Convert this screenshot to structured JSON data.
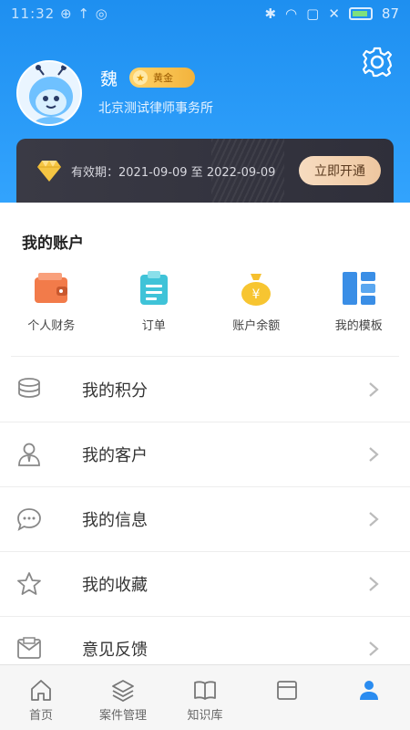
{
  "status_bar": {
    "left_text": "11:32 ⊕ ↑ ◎",
    "battery": "87"
  },
  "profile": {
    "name": "魏",
    "badge": "黄金",
    "firm": "北京测试律师事务所"
  },
  "membership": {
    "validity": "有效期：2021-09-09 至 2022-09-09",
    "button_label": "立即开通"
  },
  "account": {
    "title": "我的账户",
    "items": [
      {
        "label": "个人财务",
        "icon": "wallet-icon"
      },
      {
        "label": "订单",
        "icon": "clipboard-icon"
      },
      {
        "label": "账户余额",
        "icon": "money-bag-icon"
      },
      {
        "label": "我的模板",
        "icon": "template-grid-icon"
      }
    ]
  },
  "menu": [
    {
      "label": "我的积分",
      "icon": "coins-icon"
    },
    {
      "label": "我的客户",
      "icon": "client-icon"
    },
    {
      "label": "我的信息",
      "icon": "message-icon"
    },
    {
      "label": "我的收藏",
      "icon": "star-icon"
    },
    {
      "label": "意见反馈",
      "icon": "feedback-icon"
    }
  ],
  "tabbar": [
    {
      "label": "首页",
      "icon": "home-icon"
    },
    {
      "label": "案件管理",
      "icon": "layers-icon"
    },
    {
      "label": "知识库",
      "icon": "book-icon"
    },
    {
      "label": "",
      "icon": "calendar-icon"
    },
    {
      "label": "",
      "icon": "profile-icon"
    }
  ],
  "colors": {
    "header_blue": "#1e8ff0",
    "gold": "#f2b33c",
    "card_dark": "#2f2f3a"
  }
}
